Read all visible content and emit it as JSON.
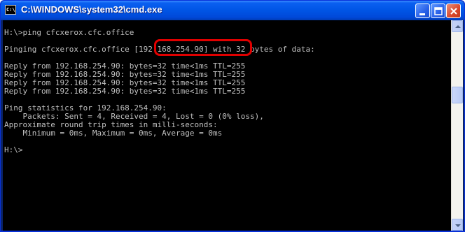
{
  "window": {
    "title": "C:\\WINDOWS\\system32\\cmd.exe",
    "icon_label": "C:\\"
  },
  "console": {
    "text": "H:\\>ping cfcxerox.cfc.office\n\nPinging cfcxerox.cfc.office [192.168.254.90] with 32 bytes of data:\n\nReply from 192.168.254.90: bytes=32 time<1ms TTL=255\nReply from 192.168.254.90: bytes=32 time<1ms TTL=255\nReply from 192.168.254.90: bytes=32 time<1ms TTL=255\nReply from 192.168.254.90: bytes=32 time<1ms TTL=255\n\nPing statistics for 192.168.254.90:\n    Packets: Sent = 4, Received = 4, Lost = 0 (0% loss),\nApproximate round trip times in milli-seconds:\n    Minimum = 0ms, Maximum = 0ms, Average = 0ms\n\nH:\\>",
    "highlighted_text": "[192.168.254.90]",
    "highlight_color": "#e00000"
  },
  "colors": {
    "titlebar": "#0055e5",
    "console_bg": "#000000",
    "console_fg": "#c0c0c0"
  },
  "icons": {
    "app": "cmd-console-icon",
    "minimize": "minimize-icon",
    "maximize": "maximize-icon",
    "close": "close-icon",
    "scroll_up": "scroll-up-arrow-icon",
    "scroll_down": "scroll-down-arrow-icon"
  },
  "scrollbar": {
    "thumb_position": 0.35
  }
}
